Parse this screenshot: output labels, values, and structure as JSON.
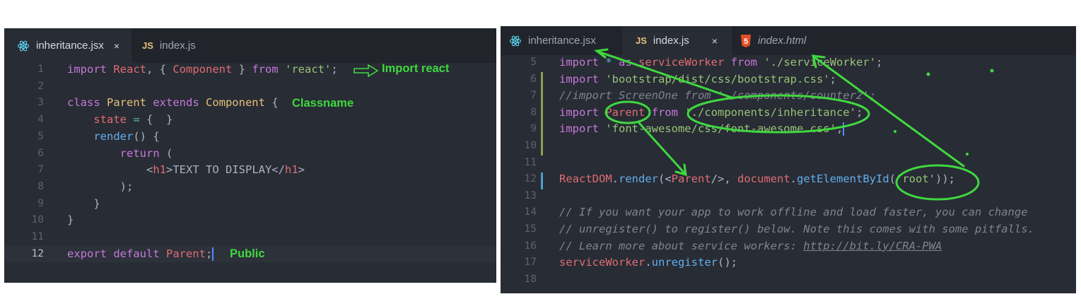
{
  "left": {
    "tabs": [
      {
        "label": "inheritance.jsx",
        "icon": "react-icon",
        "active": true,
        "close": "×"
      },
      {
        "label": "index.js",
        "icon": "js-icon",
        "icon_text": "JS",
        "active": false
      }
    ],
    "lines": [
      {
        "n": "1",
        "tokens": [
          [
            "kw",
            "import "
          ],
          [
            "vr",
            "React"
          ],
          [
            "pl",
            ", { "
          ],
          [
            "vr",
            "Component"
          ],
          [
            "pl",
            " } "
          ],
          [
            "kw",
            "from "
          ],
          [
            "st",
            "'react'"
          ],
          [
            "pl",
            ";"
          ]
        ]
      },
      {
        "n": "2",
        "tokens": []
      },
      {
        "n": "3",
        "tokens": [
          [
            "kw",
            "class "
          ],
          [
            "cl",
            "Parent "
          ],
          [
            "kw",
            "extends "
          ],
          [
            "cl",
            "Component"
          ],
          [
            "pl",
            " {"
          ]
        ]
      },
      {
        "n": "4",
        "tokens": [
          [
            "pl",
            "    "
          ],
          [
            "vr",
            "state"
          ],
          [
            "op",
            " = "
          ],
          [
            "pl",
            "{  }"
          ]
        ]
      },
      {
        "n": "5",
        "tokens": [
          [
            "pl",
            "    "
          ],
          [
            "fn",
            "render"
          ],
          [
            "pl",
            "() {"
          ]
        ]
      },
      {
        "n": "6",
        "tokens": [
          [
            "pl",
            "        "
          ],
          [
            "kw",
            "return"
          ],
          [
            "pl",
            " ("
          ]
        ]
      },
      {
        "n": "7",
        "tokens": [
          [
            "pl",
            "            <"
          ],
          [
            "vr",
            "h1"
          ],
          [
            "pl",
            ">TEXT TO DISPLAY</"
          ],
          [
            "vr",
            "h1"
          ],
          [
            "pl",
            ">"
          ]
        ]
      },
      {
        "n": "8",
        "tokens": [
          [
            "pl",
            "        );"
          ]
        ]
      },
      {
        "n": "9",
        "tokens": [
          [
            "pl",
            "    }"
          ]
        ]
      },
      {
        "n": "10",
        "tokens": [
          [
            "pl",
            "}"
          ]
        ]
      },
      {
        "n": "11",
        "tokens": []
      },
      {
        "n": "12",
        "tokens": [
          [
            "kw",
            "export default "
          ],
          [
            "vr",
            "Parent"
          ],
          [
            "pl",
            ";"
          ]
        ]
      }
    ],
    "annotations": {
      "import": "Import react",
      "classname": "Classname",
      "public": "Public"
    }
  },
  "right": {
    "tabs": [
      {
        "label": "inheritance.jsx",
        "icon": "react-icon",
        "active": false
      },
      {
        "label": "index.js",
        "icon": "js-icon",
        "icon_text": "JS",
        "active": true,
        "close": "×"
      },
      {
        "label": "index.html",
        "icon": "html5-icon",
        "icon_text": "5",
        "active": false
      }
    ],
    "lines": [
      {
        "n": "5",
        "tokens": [
          [
            "kw",
            "import "
          ],
          [
            "op",
            "* "
          ],
          [
            "kw",
            "as "
          ],
          [
            "vr",
            "serviceWorker "
          ],
          [
            "kw",
            "from "
          ],
          [
            "st",
            "'./serviceWorker'"
          ],
          [
            "pl",
            ";"
          ]
        ]
      },
      {
        "n": "6",
        "tokens": [
          [
            "kw",
            "import "
          ],
          [
            "st",
            "'bootstrap/dist/css/bootstrap.css'"
          ],
          [
            "pl",
            ";"
          ]
        ]
      },
      {
        "n": "7",
        "tokens": [
          [
            "cm",
            "//import ScreenOne from './components/counter2';"
          ]
        ]
      },
      {
        "n": "8",
        "tokens": [
          [
            "kw",
            "import "
          ],
          [
            "vr",
            "Parent "
          ],
          [
            "kw",
            "from "
          ],
          [
            "st",
            "'./components/inheritance'"
          ],
          [
            "pl",
            ";"
          ]
        ]
      },
      {
        "n": "9",
        "tokens": [
          [
            "kw",
            "import "
          ],
          [
            "st",
            "'font-awesome/css/font-awesome.css'"
          ],
          [
            "pl",
            ";"
          ]
        ]
      },
      {
        "n": "10",
        "tokens": []
      },
      {
        "n": "11",
        "tokens": []
      },
      {
        "n": "12",
        "tokens": [
          [
            "vr",
            "ReactDOM"
          ],
          [
            "pl",
            "."
          ],
          [
            "fn",
            "render"
          ],
          [
            "pl",
            "(<"
          ],
          [
            "vr",
            "Parent"
          ],
          [
            "pl",
            "/>, "
          ],
          [
            "vr",
            "document"
          ],
          [
            "pl",
            "."
          ],
          [
            "fn",
            "getElementById"
          ],
          [
            "pl",
            "("
          ],
          [
            "st",
            "'root'"
          ],
          [
            "pl",
            "));"
          ]
        ]
      },
      {
        "n": "13",
        "tokens": []
      },
      {
        "n": "14",
        "tokens": [
          [
            "cm",
            "// If you want your app to work offline and load faster, you can change"
          ]
        ]
      },
      {
        "n": "15",
        "tokens": [
          [
            "cm",
            "// unregister() to register() below. Note this comes with some pitfalls."
          ]
        ]
      },
      {
        "n": "16",
        "tokens": [
          [
            "cm",
            "// Learn more about service workers: "
          ],
          [
            "cm un",
            "http://bit.ly/CRA-PWA"
          ]
        ]
      },
      {
        "n": "17",
        "tokens": [
          [
            "vr",
            "serviceWorker"
          ],
          [
            "pl",
            "."
          ],
          [
            "fn",
            "unregister"
          ],
          [
            "pl",
            "();"
          ]
        ]
      },
      {
        "n": "18",
        "tokens": []
      }
    ]
  },
  "colors": {
    "editor_bg": "#282c34",
    "tabbar_bg": "#21252b",
    "annotation_green": "#3fd83f"
  }
}
